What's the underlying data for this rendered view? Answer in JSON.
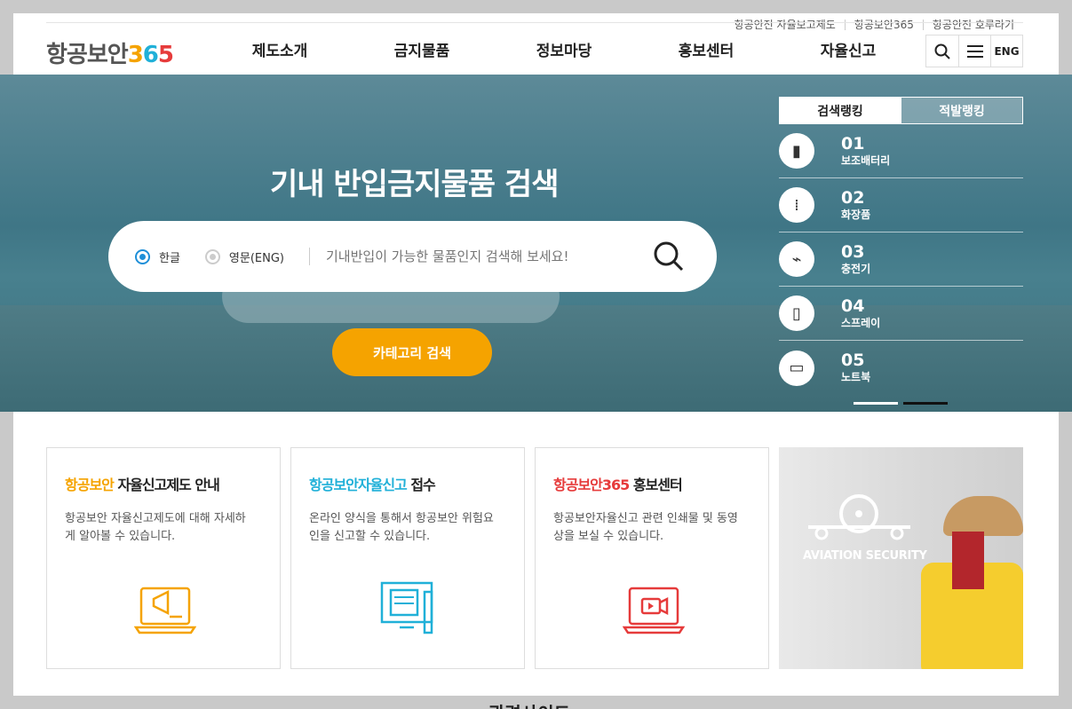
{
  "util": [
    "항공안전 자율보고제도",
    "항공보안365",
    "항공안전 호루라기"
  ],
  "logo": {
    "text": "항공보안",
    "n3": "3",
    "n6": "6",
    "n5": "5"
  },
  "gnb": [
    "제도소개",
    "금지물품",
    "정보마당",
    "홍보센터",
    "자율신고"
  ],
  "tools": {
    "search_icon": "search-icon",
    "menu_icon": "menu-icon",
    "lang": "ENG"
  },
  "hero": {
    "title": "기내 반입금지물품 검색",
    "radio_ko": "한글",
    "radio_en": "영문(ENG)",
    "placeholder": "기내반입이 가능한 물품인지 검색해 보세요!",
    "category_btn": "카테고리 검색"
  },
  "ranking": {
    "tabs": [
      "검색랭킹",
      "적발랭킹"
    ],
    "items": [
      {
        "num": "01",
        "name": "보조배터리",
        "icon": "battery-icon",
        "glyph": "▮"
      },
      {
        "num": "02",
        "name": "화장품",
        "icon": "cosmetics-icon",
        "glyph": "⁞"
      },
      {
        "num": "03",
        "name": "충전기",
        "icon": "charger-icon",
        "glyph": "⌁"
      },
      {
        "num": "04",
        "name": "스프레이",
        "icon": "spray-icon",
        "glyph": "▯"
      },
      {
        "num": "05",
        "name": "노트북",
        "icon": "laptop-icon",
        "glyph": "▭"
      }
    ],
    "pager_colors": [
      "#ffffff",
      "#111111"
    ]
  },
  "cards": [
    {
      "accent": "항공보안",
      "rest": " 자율신고제도 안내",
      "accent_color": "#f5a300",
      "desc": "항공보안 자율신고제도에 대해 자세하게 알아볼 수 있습니다."
    },
    {
      "accent": "항공보안자율신고",
      "rest": " 접수",
      "accent_color": "#20b0d8",
      "desc": "온라인 양식을 통해서 항공보안 위험요인을 신고할 수 있습니다."
    },
    {
      "accent": "항공보안365",
      "rest": " 홍보센터",
      "accent_color": "#e63b3b",
      "desc": "항공보안자율신고 관련 인쇄물 및 동영상을 보실 수 있습니다."
    }
  ],
  "photo_label": "AVIATION SECURITY",
  "footer_title": "관련사이트"
}
